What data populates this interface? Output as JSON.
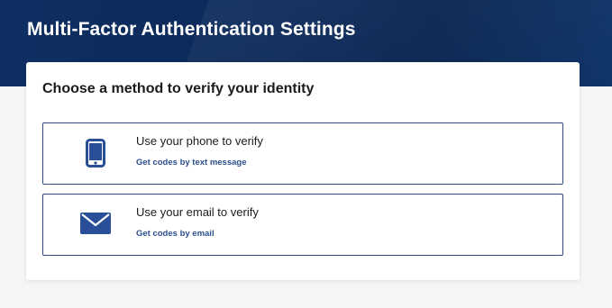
{
  "header": {
    "title": "Multi-Factor Authentication Settings"
  },
  "card": {
    "heading": "Choose a method to verify your identity",
    "options": [
      {
        "icon": "smartphone-icon",
        "title": "Use your phone to verify",
        "subtitle": "Get codes by text message"
      },
      {
        "icon": "envelope-icon",
        "title": "Use your email to verify",
        "subtitle": "Get codes by email"
      }
    ]
  },
  "colors": {
    "banner": "#0c2a5a",
    "accent": "#2b4f8f",
    "icon": "#2a4f99",
    "border": "#2f4a82"
  }
}
